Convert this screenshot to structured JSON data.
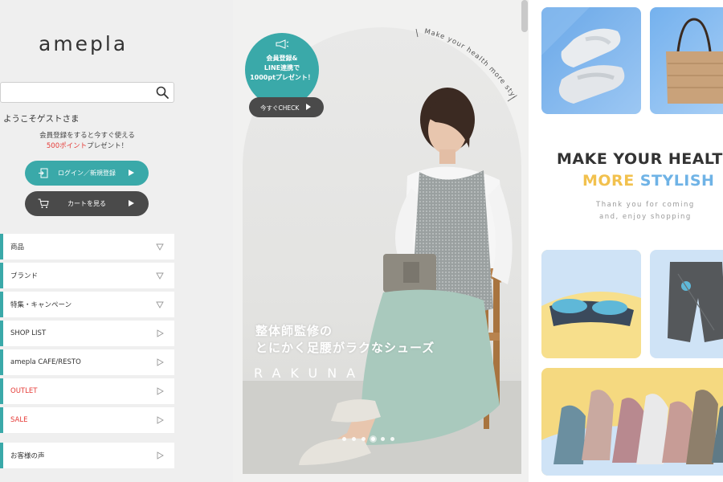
{
  "sidebar": {
    "logo": "amepla",
    "search": {
      "placeholder": "",
      "value": ""
    },
    "welcome": "ようこそゲストさま",
    "promo": {
      "line1": "会員登録をすると今すぐ使える",
      "points": "500ポイント",
      "line2_suffix": "プレゼント！"
    },
    "login_button": "ログイン／新規登録",
    "cart_button": "カートを見る",
    "menu": [
      {
        "label": "商品",
        "arrow": "triangle-down"
      },
      {
        "label": "ブランド",
        "arrow": "triangle-down"
      },
      {
        "label": "特集・キャンペーン",
        "arrow": "triangle-down"
      },
      {
        "label": "SHOP LIST",
        "arrow": "triangle-right"
      },
      {
        "label": "amepla CAFE/RESTO",
        "arrow": "triangle-right"
      },
      {
        "label": "OUTLET",
        "arrow": "triangle-right",
        "color": "#e53935"
      },
      {
        "label": "SALE",
        "arrow": "triangle-right",
        "color": "#e53935"
      }
    ],
    "menu2": [
      {
        "label": "お客様の声",
        "arrow": "triangle-right"
      }
    ]
  },
  "hero": {
    "curved_tagline": "Make your health more stylish",
    "badge": {
      "line1": "会員登録&",
      "line2": "LINE連携で",
      "line3": "1000ptプレゼント！"
    },
    "check_button": "今すぐCHECK",
    "copy_line1": "整体師監修の",
    "copy_line2": "とにかく足腰がラクなシューズ",
    "brand": "RAKUNA",
    "dots": 6,
    "active_dot": 3
  },
  "right": {
    "tagline_line1": "MAKE YOUR HEALTH",
    "tagline_line2_a": "MORE ",
    "tagline_line2_b": "STYLISH",
    "sub_line1": "Thank you for coming",
    "sub_line2": "and, enjoy shopping"
  },
  "colors": {
    "accent": "#3aa9a9",
    "dark": "#4a4a4a",
    "sale_red": "#e53935",
    "yellow": "#f2c14e",
    "light_blue": "#6fb3e6"
  }
}
